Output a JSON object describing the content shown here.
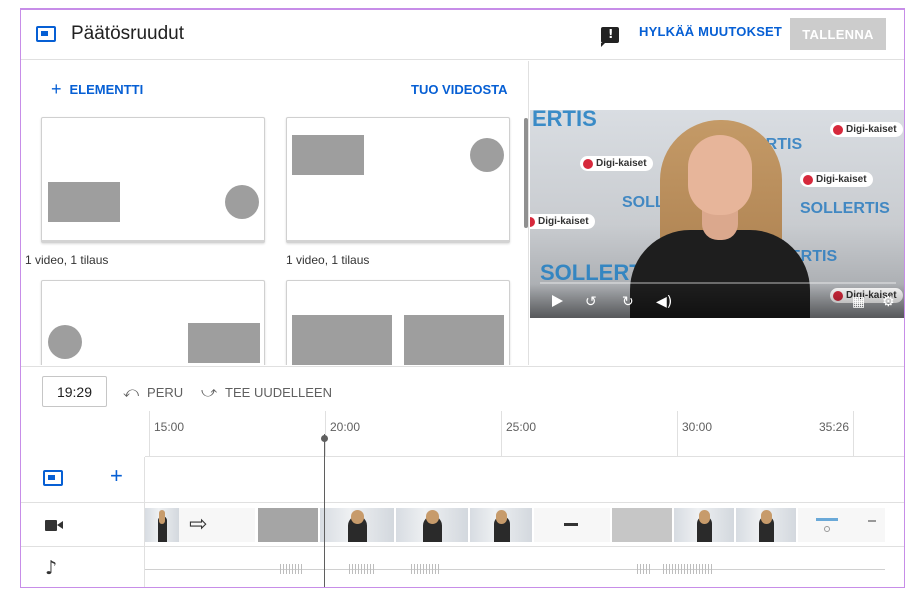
{
  "header": {
    "title": "Päätösruudut",
    "discard_label": "HYLKÄÄ MUUTOKSET",
    "save_label": "TALLENNA"
  },
  "left_panel": {
    "add_element_label": "ELEMENTTI",
    "import_label": "TUO VIDEOSTA",
    "templates": [
      {
        "label": "1 video, 1 tilaus"
      },
      {
        "label": "1 video, 1 tilaus"
      }
    ]
  },
  "preview": {
    "brand_text": "SOLLERTIS",
    "brand_partial": "ERTIS",
    "digi_text": "Digi-kaiset"
  },
  "timeline": {
    "current_time": "19:29",
    "undo_label": "PERU",
    "redo_label": "TEE UUDELLEEN",
    "ticks": [
      "15:00",
      "20:00",
      "25:00",
      "30:00",
      "35:26"
    ]
  },
  "colors": {
    "accent": "#065fd4",
    "disabled_button": "#cccccc",
    "frame_border": "#c78de8"
  }
}
